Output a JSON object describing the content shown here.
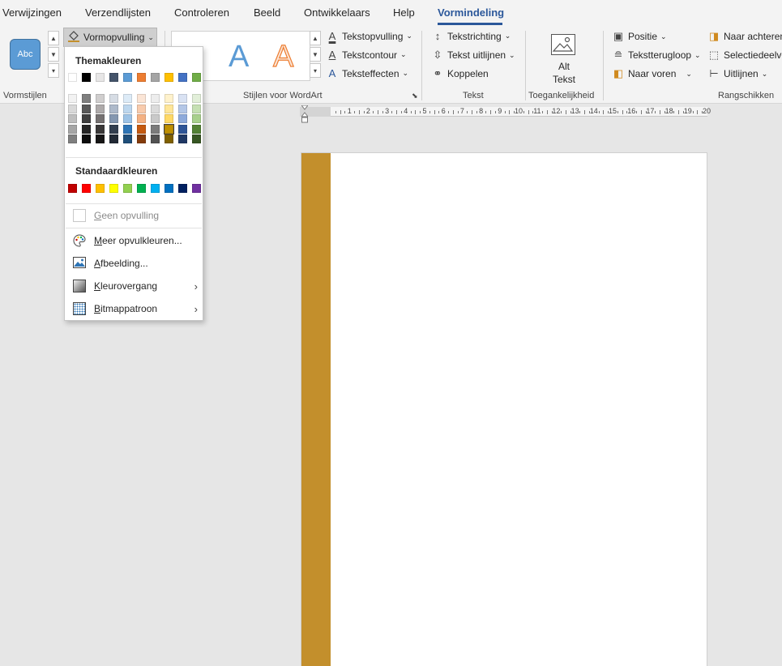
{
  "tabs": [
    "Verwijzingen",
    "Verzendlijsten",
    "Controleren",
    "Beeld",
    "Ontwikkelaars",
    "Help",
    "Vormindeling"
  ],
  "ribbon": {
    "shape_styles": {
      "preview_text": "Abc",
      "group_label": "Vormstijlen"
    },
    "fill_button_label": "Vormopvulling",
    "wordart": {
      "text_fill": "Tekstopvulling",
      "text_outline": "Tekstcontour",
      "text_effects": "Teksteffecten",
      "letter": "A",
      "group_label": "Stijlen voor WordArt"
    },
    "text": {
      "direction": "Tekstrichting",
      "align": "Tekst uitlijnen",
      "link": "Koppelen",
      "group_label": "Tekst"
    },
    "accessibility": {
      "alt_line1": "Alt",
      "alt_line2": "Tekst",
      "group_label": "Toegankelijkheid"
    },
    "arrange": {
      "position": "Positie",
      "wrap": "Tekstterugloop",
      "forward": "Naar voren",
      "backward": "Naar achteren",
      "selection": "Selectiedeelvenster",
      "align": "Uitlijnen",
      "group_label": "Rangschikken"
    }
  },
  "dropdown": {
    "theme_colors_heading": "Themakleuren",
    "theme_colors": [
      [
        "#ffffff",
        "#f2f2f2",
        "#d9d9d9",
        "#bfbfbf",
        "#a6a6a6",
        "#7f7f7f"
      ],
      [
        "#000000",
        "#7f7f7f",
        "#595959",
        "#3f3f3f",
        "#262626",
        "#0d0d0d"
      ],
      [
        "#e7e6e6",
        "#d0cece",
        "#aeaaaa",
        "#757171",
        "#3a3838",
        "#171616"
      ],
      [
        "#44546a",
        "#d6dce4",
        "#adb9ca",
        "#8497b0",
        "#333f4f",
        "#222a35"
      ],
      [
        "#5b9bd5",
        "#ddebf7",
        "#bdd7ee",
        "#9dc3e6",
        "#2e75b6",
        "#1f4e79"
      ],
      [
        "#ed7d31",
        "#fbe5d6",
        "#f8cbad",
        "#f4b183",
        "#c55a11",
        "#843c0c"
      ],
      [
        "#a5a5a5",
        "#ededed",
        "#dbdbdb",
        "#c9c9c9",
        "#7b7b7b",
        "#525252"
      ],
      [
        "#ffc000",
        "#fff2cc",
        "#ffe699",
        "#ffd966",
        "#bf9000",
        "#7f6000"
      ],
      [
        "#4472c4",
        "#d9e2f3",
        "#b4c7e7",
        "#8eaadb",
        "#2f5597",
        "#203864"
      ],
      [
        "#70ad47",
        "#e2efd9",
        "#c5e0b3",
        "#a8d08d",
        "#538135",
        "#375623"
      ]
    ],
    "selected_theme_color": "#bf9000",
    "standard_colors_heading": "Standaardkleuren",
    "standard_colors": [
      "#c00000",
      "#ff0000",
      "#ffc000",
      "#ffff00",
      "#92d050",
      "#00b050",
      "#00b0f0",
      "#0070c0",
      "#002060",
      "#7030a0"
    ],
    "no_fill": "Geen opvulling",
    "more_colors": "Meer opvulkleuren...",
    "picture": "Afbeelding...",
    "gradient": "Kleurovergang",
    "texture": "Bitmappatroon"
  },
  "ruler": {
    "numbers": [
      "1",
      "2",
      "3",
      "4",
      "5",
      "6",
      "7",
      "8",
      "9",
      "10",
      "11",
      "12",
      "13",
      "14",
      "15",
      "16",
      "17",
      "18",
      "19",
      "20"
    ]
  },
  "document": {
    "shape_color": "#c38f2c"
  }
}
